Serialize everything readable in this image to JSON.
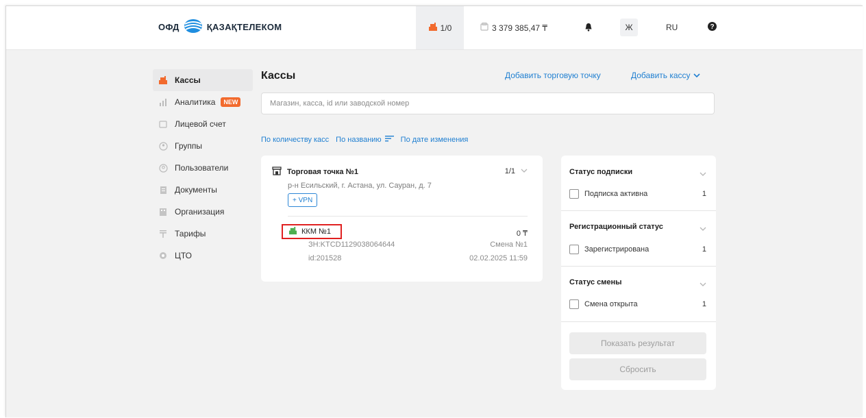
{
  "header": {
    "logo_ofd": "ОФД",
    "logo_brand": "ҚАЗАҚТЕЛЕКОМ",
    "kkm_counter": "1/0",
    "balance": "3 379 385,47 ₸",
    "lang_kz": "Ж",
    "lang": "RU"
  },
  "sidebar": {
    "items": [
      {
        "label": "Кассы",
        "icon": "cash-register-icon",
        "active": true
      },
      {
        "label": "Аналитика",
        "icon": "analytics-icon",
        "badge": "NEW"
      },
      {
        "label": "Лицевой счет",
        "icon": "wallet-icon"
      },
      {
        "label": "Группы",
        "icon": "groups-icon"
      },
      {
        "label": "Пользователи",
        "icon": "user-icon"
      },
      {
        "label": "Документы",
        "icon": "document-icon"
      },
      {
        "label": "Организация",
        "icon": "organization-icon"
      },
      {
        "label": "Тарифы",
        "icon": "tariff-icon"
      },
      {
        "label": "ЦТО",
        "icon": "cto-icon"
      }
    ]
  },
  "main": {
    "title": "Кассы",
    "add_point": "Добавить торговую точку",
    "add_kassa": "Добавить кассу",
    "search_placeholder": "Магазин, касса, id или заводской номер",
    "sort": {
      "by_count": "По количеству касс",
      "by_name": "По названию",
      "by_date": "По дате изменения"
    },
    "trade_point": {
      "title": "Торговая точка №1",
      "count": "1/1",
      "address": "р-н Есильский, г. Астана, ул. Сауран, д. 7",
      "vpn_button": "+ VPN",
      "kkm": {
        "name": "ККМ №1",
        "sum": "0 ₸",
        "zn": "ЗН:KTCD1129038064644",
        "shift": "Смена №1",
        "id": "id:201528",
        "date": "02.02.2025 11:59"
      }
    }
  },
  "filters": {
    "subscription": {
      "title": "Статус подписки",
      "option": "Подписка активна",
      "count": "1"
    },
    "registration": {
      "title": "Регистрационный статус",
      "option": "Зарегистрирована",
      "count": "1"
    },
    "shift": {
      "title": "Статус смены",
      "option": "Смена открыта",
      "count": "1"
    },
    "show_button": "Показать результат",
    "reset_button": "Сбросить"
  },
  "colors": {
    "accent": "#1f7fd1",
    "kkm_icon": "#f26a2d",
    "kkm_item_icon": "#4caf50",
    "badge": "#f26a2d",
    "highlight": "#e02020"
  }
}
